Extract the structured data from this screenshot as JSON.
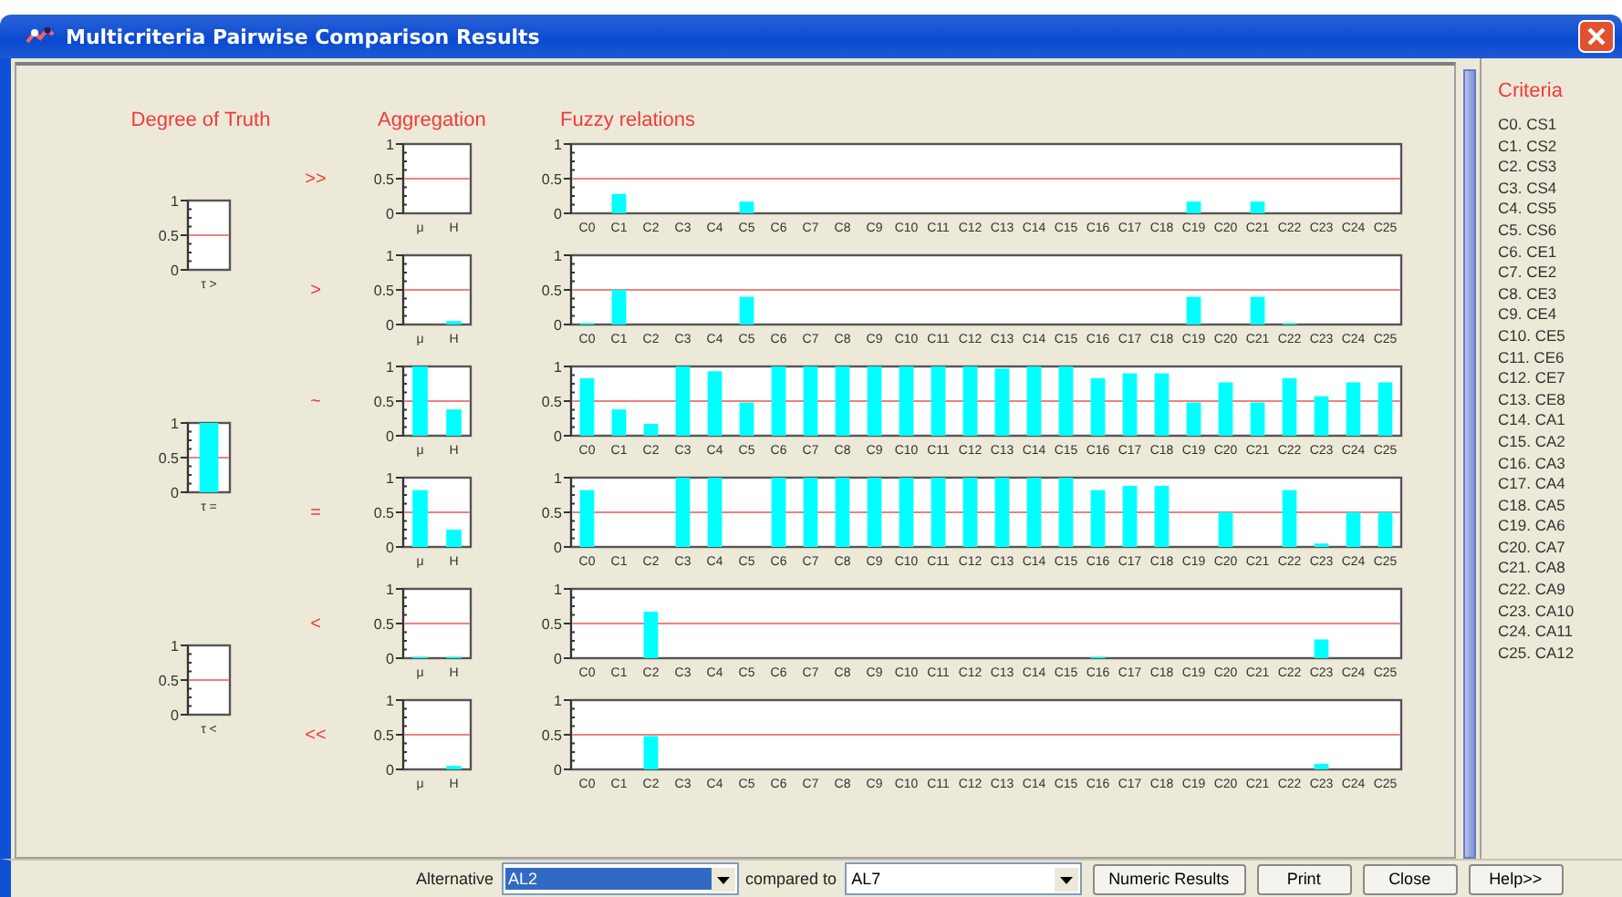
{
  "window": {
    "title": "Multicriteria Pairwise Comparison Results"
  },
  "truth": {
    "title": "Degree of Truth",
    "charts": [
      {
        "chart_data": {
          "type": "bar",
          "categories": [
            "τ >"
          ],
          "values": [
            0
          ],
          "ylim": [
            0,
            1
          ],
          "yticks": [
            0,
            0.5,
            1
          ],
          "ref_lines": [
            {
              "axis": "y",
              "value": 0.5
            }
          ]
        }
      },
      {
        "chart_data": {
          "type": "bar",
          "categories": [
            "τ ="
          ],
          "values": [
            1
          ],
          "ylim": [
            0,
            1
          ],
          "yticks": [
            0,
            0.5,
            1
          ],
          "ref_lines": [
            {
              "axis": "y",
              "value": 0.5
            }
          ]
        }
      },
      {
        "chart_data": {
          "type": "bar",
          "categories": [
            "τ <"
          ],
          "values": [
            0
          ],
          "ylim": [
            0,
            1
          ],
          "yticks": [
            0,
            0.5,
            1
          ],
          "ref_lines": [
            {
              "axis": "y",
              "value": 0.5
            }
          ]
        }
      }
    ]
  },
  "aggregation_title": "Aggregation",
  "fuzzy_title": "Fuzzy relations",
  "relations": [
    {
      "symbol": ">>",
      "aggregation": {
        "chart_data": {
          "type": "bar",
          "categories": [
            "μ",
            "H"
          ],
          "values": [
            0,
            0
          ],
          "ylim": [
            0,
            1
          ],
          "yticks": [
            0,
            0.5,
            1
          ],
          "ref_lines": [
            {
              "axis": "y",
              "value": 0.5
            }
          ]
        }
      },
      "fuzzy": {
        "chart_data": {
          "type": "bar",
          "categories": [
            "C0",
            "C1",
            "C2",
            "C3",
            "C4",
            "C5",
            "C6",
            "C7",
            "C8",
            "C9",
            "C10",
            "C11",
            "C12",
            "C13",
            "C14",
            "C15",
            "C16",
            "C17",
            "C18",
            "C19",
            "C20",
            "C21",
            "C22",
            "C23",
            "C24",
            "C25"
          ],
          "values": [
            0,
            0.28,
            0,
            0,
            0,
            0.17,
            0,
            0,
            0,
            0,
            0,
            0,
            0,
            0,
            0,
            0,
            0,
            0,
            0,
            0.17,
            0,
            0.17,
            0,
            0,
            0,
            0
          ],
          "ylim": [
            0,
            1
          ],
          "yticks": [
            0,
            0.5,
            1
          ],
          "ref_lines": [
            {
              "axis": "y",
              "value": 0.5
            }
          ]
        }
      }
    },
    {
      "symbol": ">",
      "aggregation": {
        "chart_data": {
          "type": "bar",
          "categories": [
            "μ",
            "H"
          ],
          "values": [
            0,
            0.05
          ],
          "ylim": [
            0,
            1
          ],
          "yticks": [
            0,
            0.5,
            1
          ],
          "ref_lines": [
            {
              "axis": "y",
              "value": 0.5
            }
          ]
        }
      },
      "fuzzy": {
        "chart_data": {
          "type": "bar",
          "categories": [
            "C0",
            "C1",
            "C2",
            "C3",
            "C4",
            "C5",
            "C6",
            "C7",
            "C8",
            "C9",
            "C10",
            "C11",
            "C12",
            "C13",
            "C14",
            "C15",
            "C16",
            "C17",
            "C18",
            "C19",
            "C20",
            "C21",
            "C22",
            "C23",
            "C24",
            "C25"
          ],
          "values": [
            0.02,
            0.5,
            0,
            0,
            0,
            0.4,
            0,
            0,
            0,
            0,
            0,
            0,
            0,
            0,
            0,
            0,
            0,
            0,
            0,
            0.4,
            0,
            0.4,
            0.02,
            0,
            0,
            0
          ],
          "ylim": [
            0,
            1
          ],
          "yticks": [
            0,
            0.5,
            1
          ],
          "ref_lines": [
            {
              "axis": "y",
              "value": 0.5
            }
          ]
        }
      }
    },
    {
      "symbol": "~",
      "aggregation": {
        "chart_data": {
          "type": "bar",
          "categories": [
            "μ",
            "H"
          ],
          "values": [
            1,
            0.38
          ],
          "ylim": [
            0,
            1
          ],
          "yticks": [
            0,
            0.5,
            1
          ],
          "ref_lines": [
            {
              "axis": "y",
              "value": 0.5
            }
          ]
        }
      },
      "fuzzy": {
        "chart_data": {
          "type": "bar",
          "categories": [
            "C0",
            "C1",
            "C2",
            "C3",
            "C4",
            "C5",
            "C6",
            "C7",
            "C8",
            "C9",
            "C10",
            "C11",
            "C12",
            "C13",
            "C14",
            "C15",
            "C16",
            "C17",
            "C18",
            "C19",
            "C20",
            "C21",
            "C22",
            "C23",
            "C24",
            "C25"
          ],
          "values": [
            0.83,
            0.38,
            0.17,
            1,
            0.93,
            0.48,
            1,
            1,
            1,
            1,
            1,
            1,
            1,
            0.97,
            1,
            1,
            0.83,
            0.9,
            0.9,
            0.48,
            0.77,
            0.48,
            0.83,
            0.57,
            0.77,
            0.77
          ],
          "ylim": [
            0,
            1
          ],
          "yticks": [
            0,
            0.5,
            1
          ],
          "ref_lines": [
            {
              "axis": "y",
              "value": 0.5
            }
          ]
        }
      }
    },
    {
      "symbol": "=",
      "aggregation": {
        "chart_data": {
          "type": "bar",
          "categories": [
            "μ",
            "H"
          ],
          "values": [
            0.82,
            0.25
          ],
          "ylim": [
            0,
            1
          ],
          "yticks": [
            0,
            0.5,
            1
          ],
          "ref_lines": [
            {
              "axis": "y",
              "value": 0.5
            }
          ]
        }
      },
      "fuzzy": {
        "chart_data": {
          "type": "bar",
          "categories": [
            "C0",
            "C1",
            "C2",
            "C3",
            "C4",
            "C5",
            "C6",
            "C7",
            "C8",
            "C9",
            "C10",
            "C11",
            "C12",
            "C13",
            "C14",
            "C15",
            "C16",
            "C17",
            "C18",
            "C19",
            "C20",
            "C21",
            "C22",
            "C23",
            "C24",
            "C25"
          ],
          "values": [
            0.82,
            0,
            0,
            1,
            1,
            0,
            1,
            1,
            1,
            1,
            1,
            1,
            1,
            1,
            1,
            1,
            0.82,
            0.88,
            0.88,
            0,
            0.5,
            0,
            0.82,
            0.05,
            0.5,
            0.5
          ],
          "ylim": [
            0,
            1
          ],
          "yticks": [
            0,
            0.5,
            1
          ],
          "ref_lines": [
            {
              "axis": "y",
              "value": 0.5
            }
          ]
        }
      }
    },
    {
      "symbol": "<",
      "aggregation": {
        "chart_data": {
          "type": "bar",
          "categories": [
            "μ",
            "H"
          ],
          "values": [
            0.02,
            0.02
          ],
          "ylim": [
            0,
            1
          ],
          "yticks": [
            0,
            0.5,
            1
          ],
          "ref_lines": [
            {
              "axis": "y",
              "value": 0.5
            }
          ]
        }
      },
      "fuzzy": {
        "chart_data": {
          "type": "bar",
          "categories": [
            "C0",
            "C1",
            "C2",
            "C3",
            "C4",
            "C5",
            "C6",
            "C7",
            "C8",
            "C9",
            "C10",
            "C11",
            "C12",
            "C13",
            "C14",
            "C15",
            "C16",
            "C17",
            "C18",
            "C19",
            "C20",
            "C21",
            "C22",
            "C23",
            "C24",
            "C25"
          ],
          "values": [
            0,
            0,
            0.67,
            0,
            0,
            0,
            0,
            0,
            0,
            0,
            0,
            0,
            0,
            0,
            0,
            0,
            0.02,
            0,
            0,
            0,
            0,
            0,
            0,
            0.27,
            0,
            0
          ],
          "ylim": [
            0,
            1
          ],
          "yticks": [
            0,
            0.5,
            1
          ],
          "ref_lines": [
            {
              "axis": "y",
              "value": 0.5
            }
          ]
        }
      }
    },
    {
      "symbol": "<<",
      "aggregation": {
        "chart_data": {
          "type": "bar",
          "categories": [
            "μ",
            "H"
          ],
          "values": [
            0,
            0.05
          ],
          "ylim": [
            0,
            1
          ],
          "yticks": [
            0,
            0.5,
            1
          ],
          "ref_lines": [
            {
              "axis": "y",
              "value": 0.5
            }
          ]
        }
      },
      "fuzzy": {
        "chart_data": {
          "type": "bar",
          "categories": [
            "C0",
            "C1",
            "C2",
            "C3",
            "C4",
            "C5",
            "C6",
            "C7",
            "C8",
            "C9",
            "C10",
            "C11",
            "C12",
            "C13",
            "C14",
            "C15",
            "C16",
            "C17",
            "C18",
            "C19",
            "C20",
            "C21",
            "C22",
            "C23",
            "C24",
            "C25"
          ],
          "values": [
            0,
            0,
            0.48,
            0,
            0,
            0,
            0,
            0,
            0,
            0,
            0,
            0,
            0,
            0,
            0,
            0,
            0,
            0,
            0,
            0,
            0,
            0,
            0,
            0.08,
            0,
            0
          ],
          "ylim": [
            0,
            1
          ],
          "yticks": [
            0,
            0.5,
            1
          ],
          "ref_lines": [
            {
              "axis": "y",
              "value": 0.5
            }
          ]
        }
      }
    }
  ],
  "criteria": {
    "title": "Criteria",
    "items": [
      "C0. CS1",
      "C1. CS2",
      "C2. CS3",
      "C3. CS4",
      "C4. CS5",
      "C5. CS6",
      "C6. CE1",
      "C7. CE2",
      "C8. CE3",
      "C9. CE4",
      "C10. CE5",
      "C11. CE6",
      "C12. CE7",
      "C13. CE8",
      "C14. CA1",
      "C15. CA2",
      "C16. CA3",
      "C17. CA4",
      "C18. CA5",
      "C19. CA6",
      "C20. CA7",
      "C21. CA8",
      "C22. CA9",
      "C23. CA10",
      "C24. CA11",
      "C25. CA12"
    ]
  },
  "footer": {
    "alternative": {
      "label": "Alternative",
      "value": "AL2"
    },
    "compared_to": {
      "label": "compared to",
      "value": "AL7"
    },
    "buttons": [
      "Numeric Results",
      "Print",
      "Close",
      "Help>>"
    ]
  }
}
